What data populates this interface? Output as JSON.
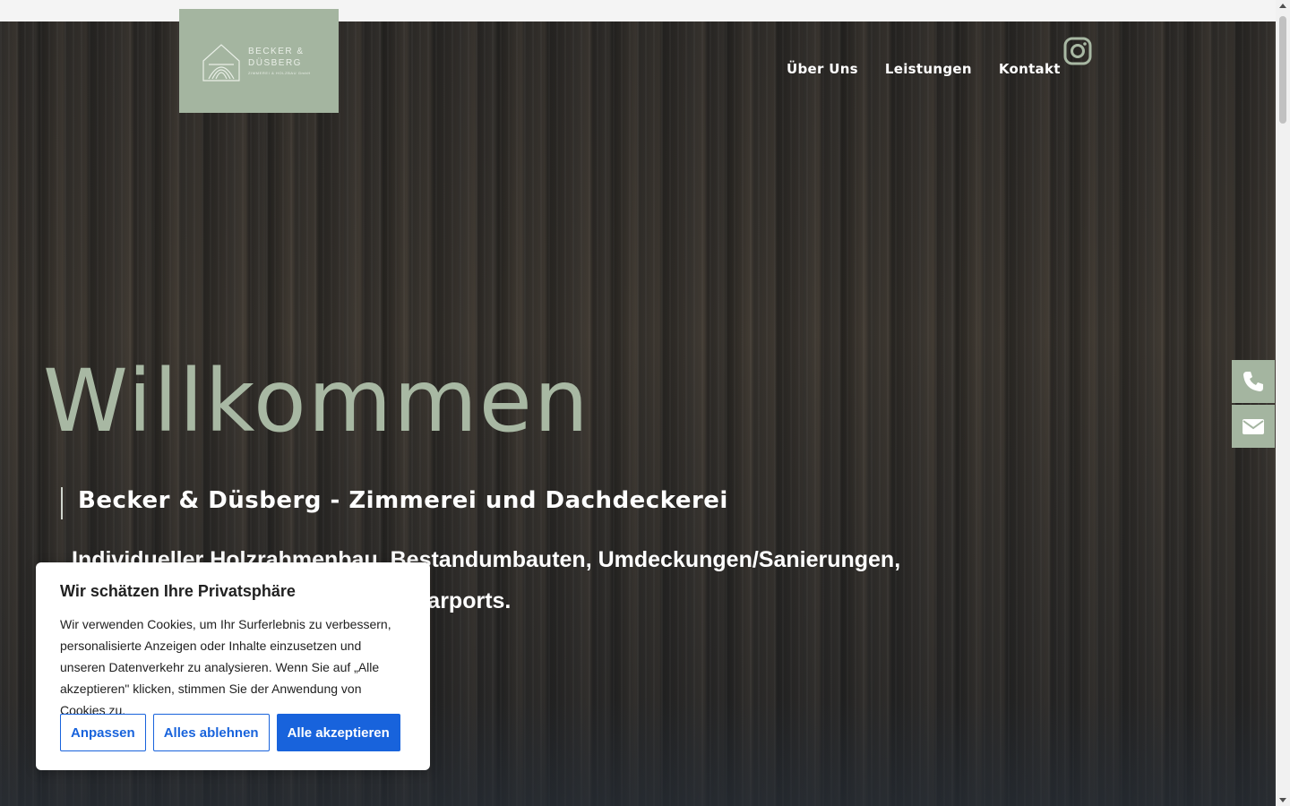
{
  "header": {
    "logo_line1": "BECKER &",
    "logo_line2": "DÜSBERG",
    "logo_line3": "ZIMMEREI & HOLZBAU GmbH",
    "nav": [
      {
        "label": "Über Uns"
      },
      {
        "label": "Leistungen"
      },
      {
        "label": "Kontakt"
      }
    ],
    "social_icon": "instagram-icon"
  },
  "hero": {
    "title": "Willkommen",
    "subtitle": "Becker & Düsberg - Zimmerei und Dachdeckerei",
    "lead": "Individueller Holzrahmenbau, Bestandumbauten, Umdeckungen/Sanierungen, Holzfassaden, Dachfenster und Carports."
  },
  "side_actions": [
    {
      "icon": "phone-icon"
    },
    {
      "icon": "envelope-icon"
    }
  ],
  "cookie_banner": {
    "title": "Wir schätzen Ihre Privatsphäre",
    "text": "Wir verwenden Cookies, um Ihr Surferlebnis zu verbessern, personalisierte Anzeigen oder Inhalte einzusetzen und unseren Datenverkehr zu analysieren. Wenn Sie auf „Alle akzeptieren\" klicken, stimmen Sie der Anwendung von Cookies zu.",
    "buttons": {
      "customize": "Anpassen",
      "reject": "Alles ablehnen",
      "accept": "Alle akzeptieren"
    }
  },
  "colors": {
    "brand_sage": "#a4b5a0",
    "title_sage": "#a8b8a3",
    "cookie_blue": "#1863dc"
  }
}
